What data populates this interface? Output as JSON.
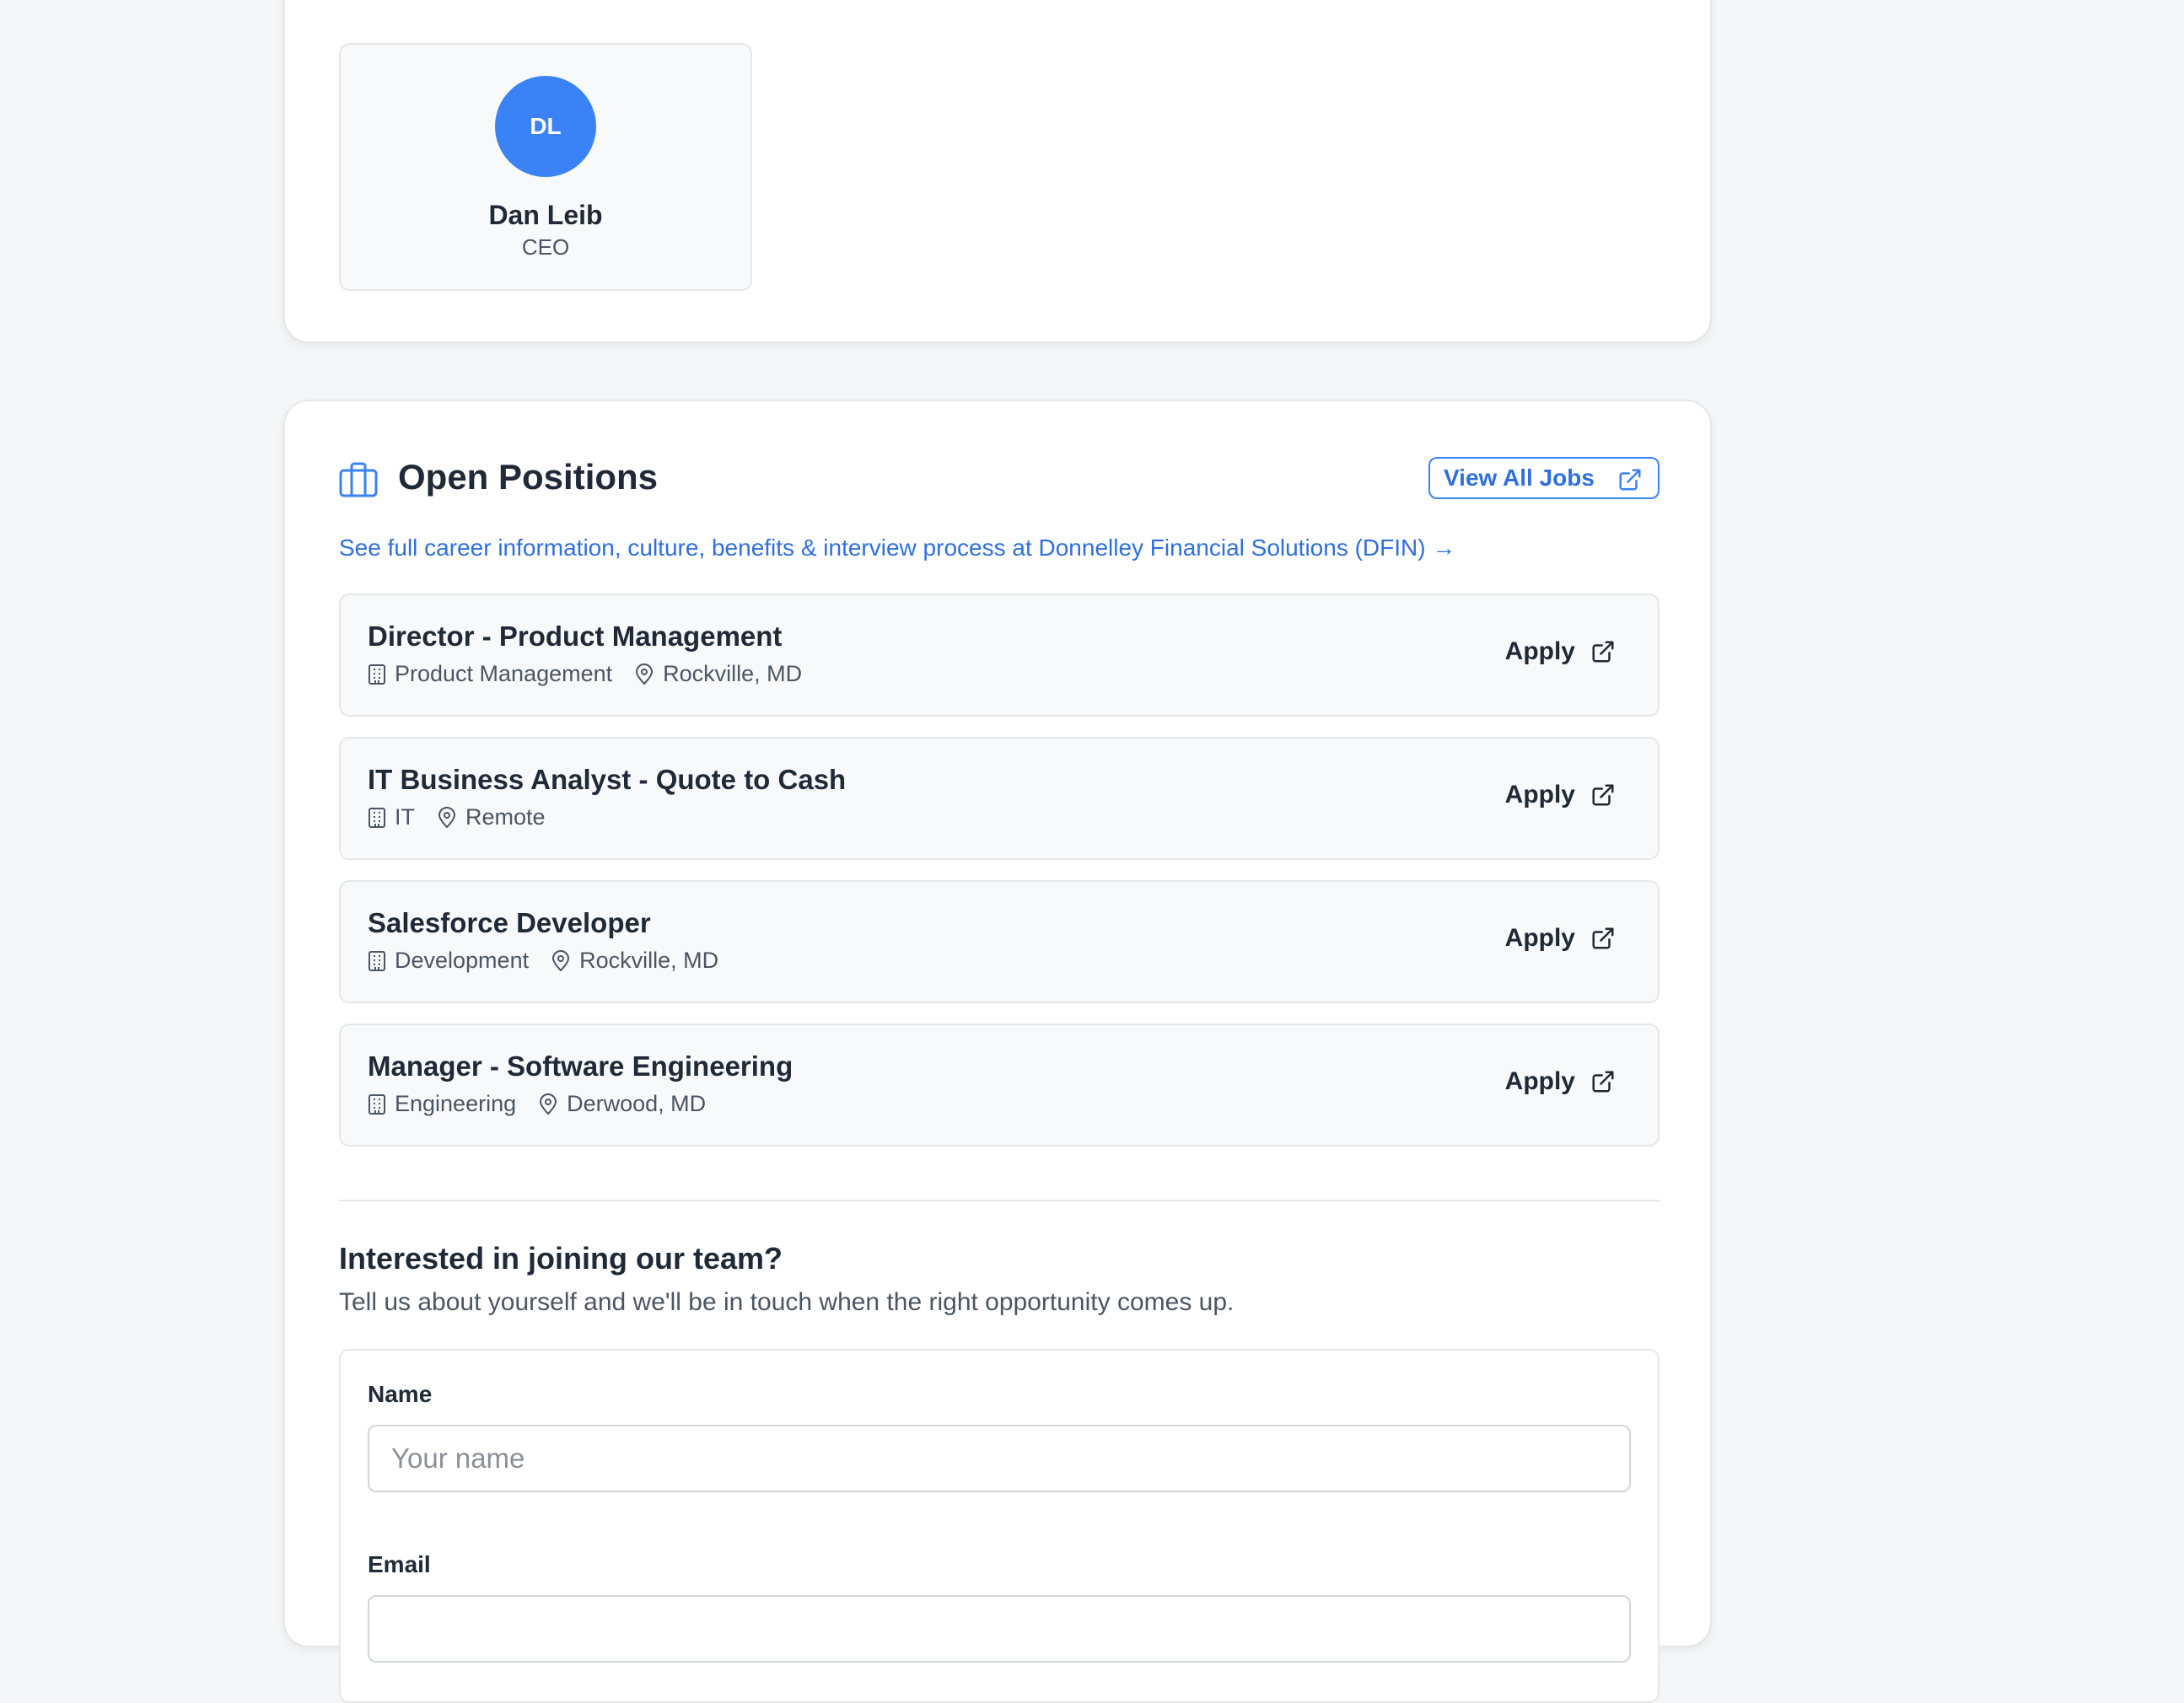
{
  "leadership": {
    "person": {
      "initials": "DL",
      "name": "Dan Leib",
      "role": "CEO"
    }
  },
  "positions": {
    "title": "Open Positions",
    "view_all_label": "View All Jobs",
    "career_link": "See full career information, culture, benefits & interview process at Donnelley Financial Solutions (DFIN) →",
    "jobs": [
      {
        "title": "Director - Product Management",
        "department": "Product Management",
        "location": "Rockville, MD",
        "apply_label": "Apply"
      },
      {
        "title": "IT Business Analyst - Quote to Cash",
        "department": "IT",
        "location": "Remote",
        "apply_label": "Apply"
      },
      {
        "title": "Salesforce Developer",
        "department": "Development",
        "location": "Rockville, MD",
        "apply_label": "Apply"
      },
      {
        "title": "Manager - Software Engineering",
        "department": "Engineering",
        "location": "Derwood, MD",
        "apply_label": "Apply"
      }
    ]
  },
  "interest": {
    "title": "Interested in joining our team?",
    "subtitle": "Tell us about yourself and we'll be in touch when the right opportunity comes up.",
    "form": {
      "name_label": "Name",
      "name_placeholder": "Your name",
      "email_label": "Email"
    }
  },
  "colors": {
    "accent": "#3b82f6",
    "link": "#2f6fdd",
    "background": "#f5f6f8"
  }
}
